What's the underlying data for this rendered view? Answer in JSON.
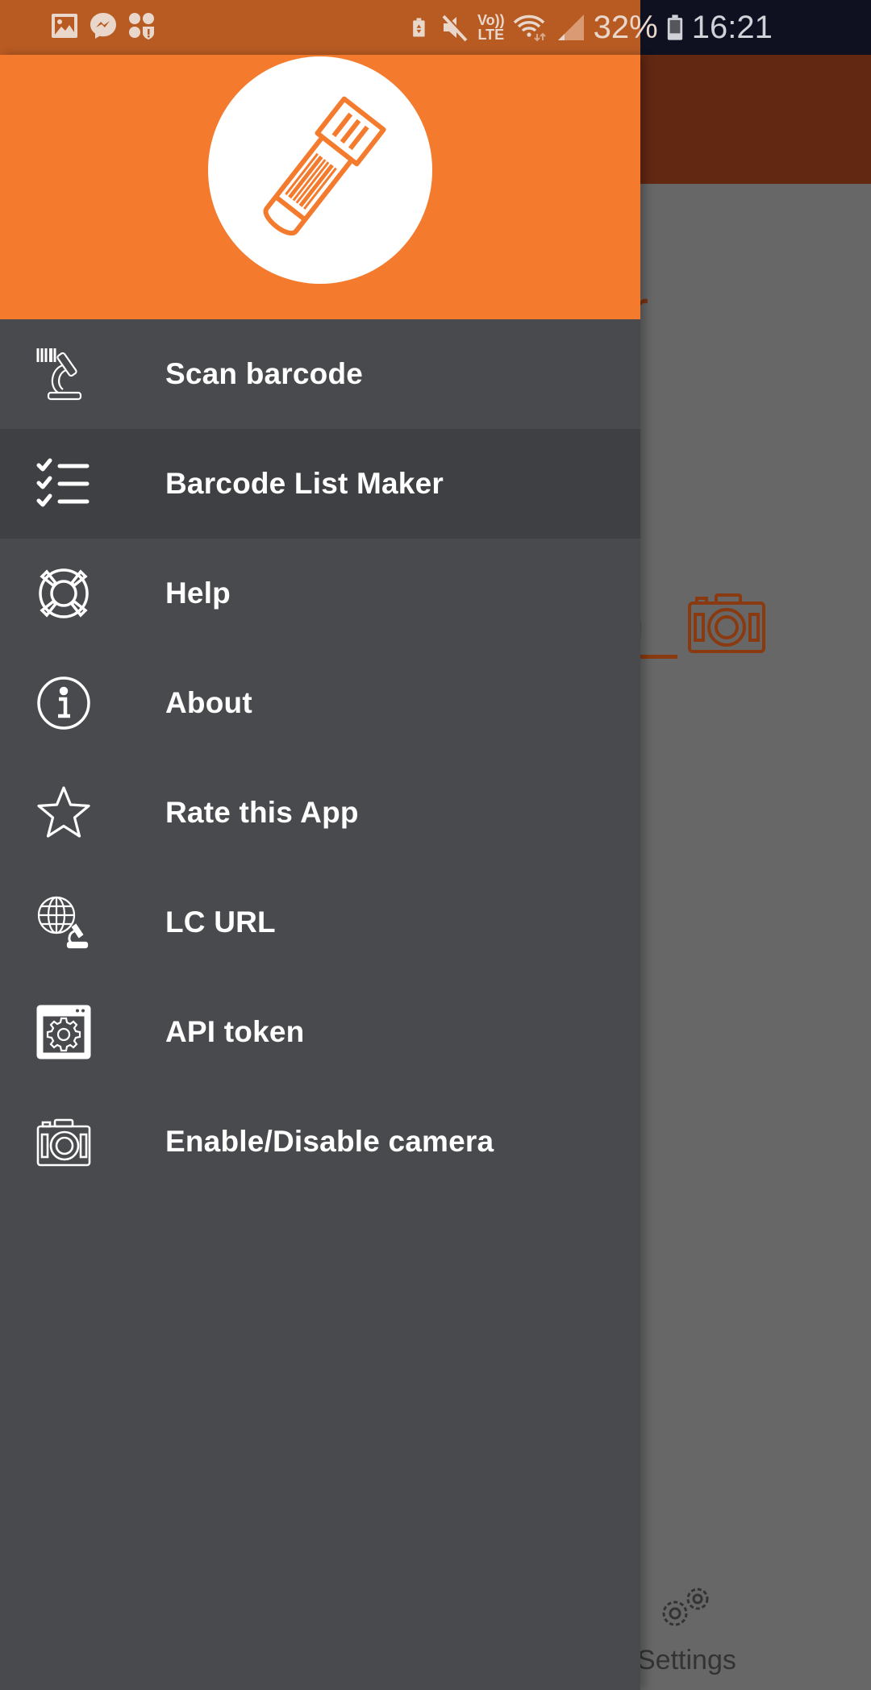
{
  "status_bar": {
    "left_icons": [
      "gallery-icon",
      "messenger-icon",
      "apps-security-icon"
    ],
    "right_icons": [
      "battery-saver-icon",
      "mute-icon",
      "volte-icon",
      "wifi-icon",
      "signal-icon"
    ],
    "volte_label_top": "Vo))",
    "volte_label_bottom": "LTE",
    "battery_percent": "32%",
    "time": "16:21"
  },
  "drawer": {
    "header": {
      "logo_icon": "test-tube-barcode-icon",
      "colors": {
        "header_bg": "#F47B2E",
        "logo_bg": "#FFFFFF",
        "logo_stroke": "#F47B2E"
      }
    },
    "items": [
      {
        "label": "Scan barcode",
        "icon": "barcode-microscope-icon",
        "selected": false
      },
      {
        "label": "Barcode List Maker",
        "icon": "checklist-icon",
        "selected": true
      },
      {
        "label": "Help",
        "icon": "lifebuoy-icon",
        "selected": false
      },
      {
        "label": "About",
        "icon": "info-icon",
        "selected": false
      },
      {
        "label": "Rate this App",
        "icon": "star-icon",
        "selected": false
      },
      {
        "label": "LC URL",
        "icon": "globe-microscope-icon",
        "selected": false
      },
      {
        "label": "API token",
        "icon": "window-gear-icon",
        "selected": false
      },
      {
        "label": "Enable/Disable camera",
        "icon": "camera-icon",
        "selected": false
      }
    ],
    "colors": {
      "bg": "#494A4E",
      "selected_bg": "#3F4044",
      "text": "#FFFFFF"
    }
  },
  "background_app": {
    "title_fragment": "r",
    "input_fragment": "n",
    "camera_icon": "camera-icon",
    "settings_label": "Settings",
    "settings_icon": "gears-icon",
    "colors": {
      "toolbar": "#632812",
      "accent": "#8A3A10",
      "scrim_bg": "#676767"
    }
  }
}
